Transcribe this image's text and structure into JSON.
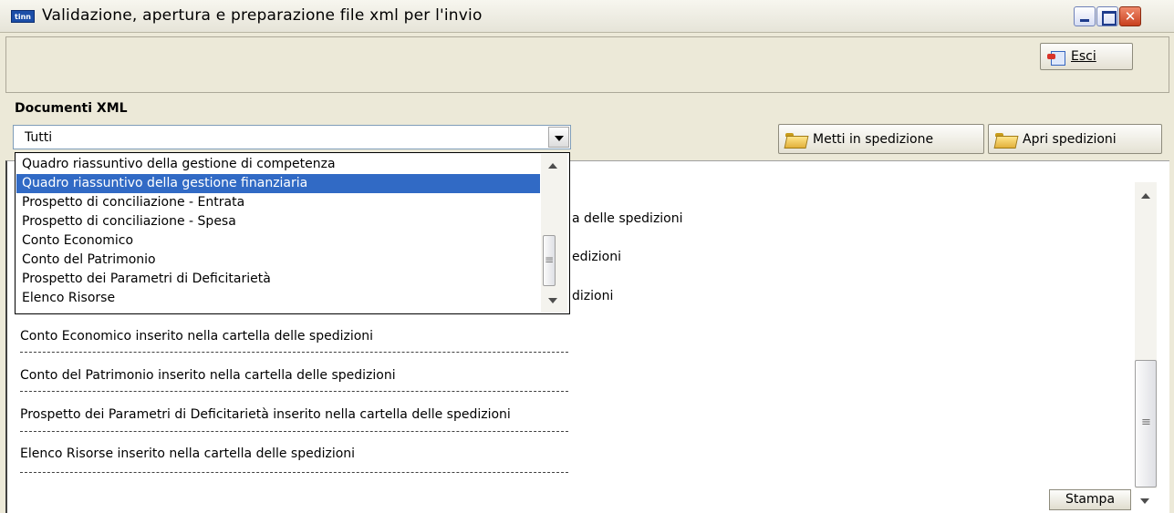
{
  "window": {
    "title": "Validazione, apertura e preparazione file xml per l'invio",
    "app_icon_label": "tinn"
  },
  "toolbar": {
    "exit_label": "Esci"
  },
  "documents": {
    "section_title": "Documenti XML",
    "filter_selected": "Tutti",
    "dropdown_items": [
      "Quadro riassuntivo della gestione di competenza",
      "Quadro riassuntivo della gestione finanziaria",
      "Prospetto di conciliazione - Entrata",
      "Prospetto di conciliazione - Spesa",
      "Conto Economico",
      "Conto del Patrimonio",
      "Prospetto dei Parametri di Deficitarietà",
      "Elenco Risorse"
    ],
    "dropdown_selected_index": 1
  },
  "actions": {
    "metti_label": "Metti in spedizione",
    "apri_label": "Apri spedizioni"
  },
  "log": {
    "partial_lines": [
      "a delle spedizioni",
      "edizioni",
      "dizioni"
    ],
    "lines": [
      "Conto Economico inserito nella cartella delle spedizioni",
      "Conto del Patrimonio inserito nella cartella delle spedizioni",
      "Prospetto dei Parametri di Deficitarietà inserito nella cartella delle spedizioni",
      "Elenco Risorse inserito nella cartella delle spedizioni"
    ]
  },
  "footer": {
    "print_label": "Stampa"
  }
}
